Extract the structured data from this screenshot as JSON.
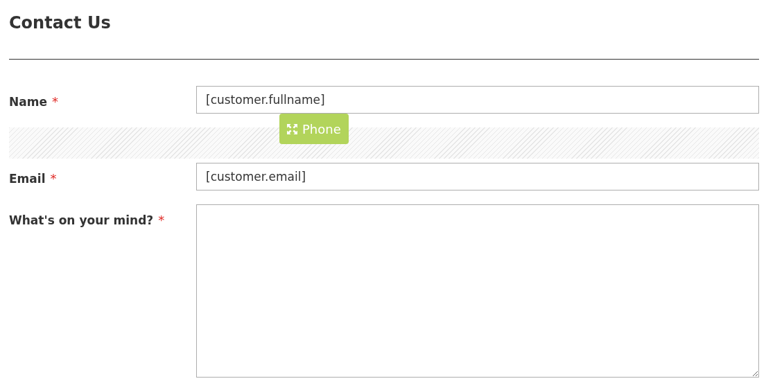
{
  "title": "Contact Us",
  "fields": [
    {
      "kind": "text",
      "label": "Name",
      "required_mark": "*",
      "value": "[customer.fullname]"
    },
    {
      "kind": "drop_zone",
      "dragged_item": {
        "label": "Phone"
      }
    },
    {
      "kind": "text",
      "label": "Email",
      "required_mark": "*",
      "value": "[customer.email]"
    },
    {
      "kind": "textarea",
      "label": "What's on your mind?",
      "required_mark": "*"
    }
  ]
}
